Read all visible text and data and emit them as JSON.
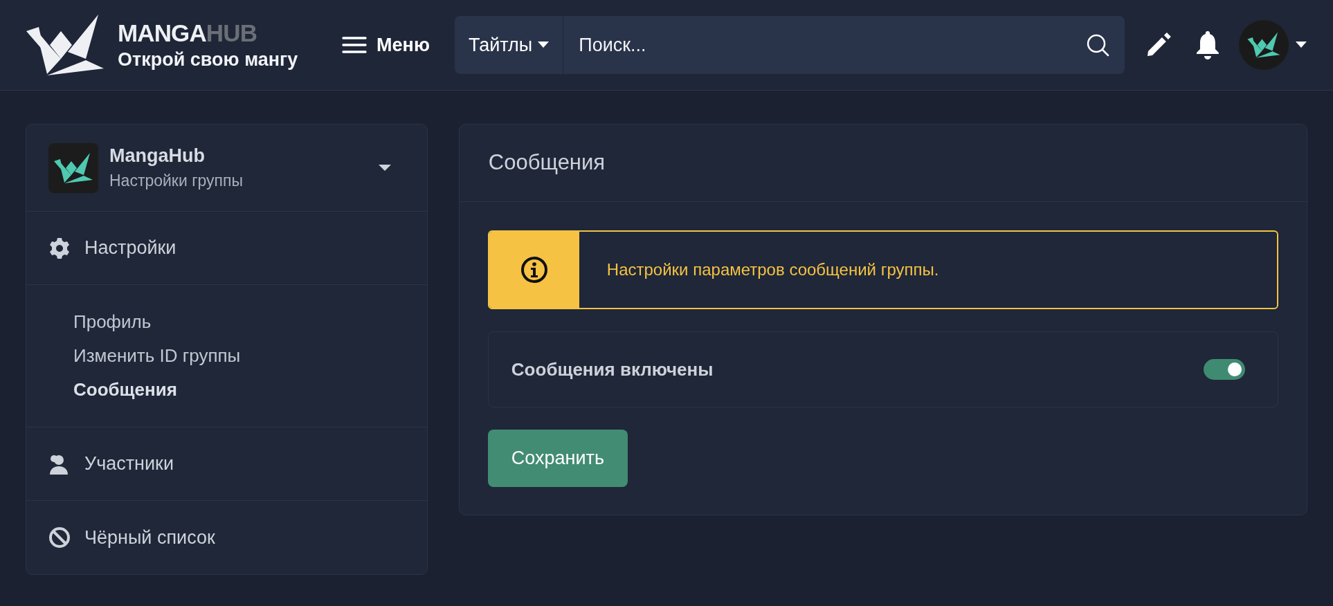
{
  "header": {
    "brand": {
      "primary": "MANGA",
      "secondary": "HUB"
    },
    "tagline": "Открой свою мангу",
    "menu_label": "Меню",
    "search": {
      "category": "Тайтлы",
      "placeholder": "Поиск..."
    }
  },
  "sidebar": {
    "group": {
      "name": "MangaHub",
      "subtitle": "Настройки группы"
    },
    "sections": [
      {
        "label": "Настройки",
        "children": [
          {
            "label": "Профиль",
            "selected": false
          },
          {
            "label": "Изменить ID группы",
            "selected": false
          },
          {
            "label": "Сообщения",
            "selected": true
          }
        ]
      },
      {
        "label": "Участники"
      },
      {
        "label": "Чёрный список"
      }
    ]
  },
  "main": {
    "title": "Сообщения",
    "alert": "Настройки параметров сообщений группы.",
    "toggle": {
      "label": "Сообщения включены",
      "on": true
    },
    "save_button": "Сохранить"
  }
}
